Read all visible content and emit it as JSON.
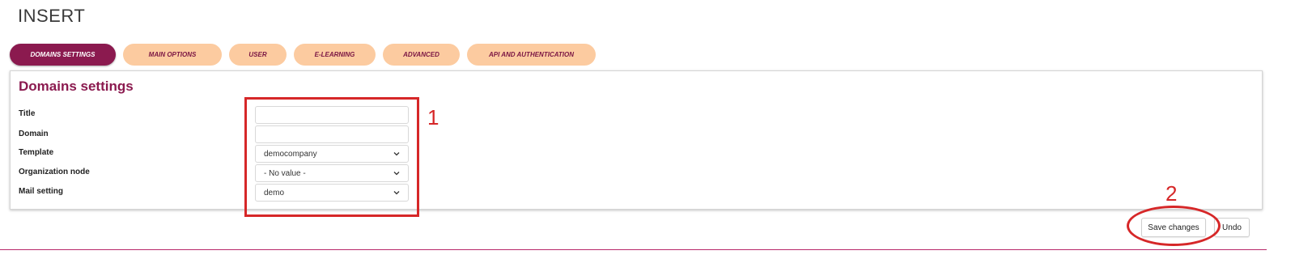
{
  "page": {
    "title": "INSERT"
  },
  "tabs": [
    {
      "label": "DOMAINS SETTINGS",
      "active": true
    },
    {
      "label": "MAIN OPTIONS",
      "active": false
    },
    {
      "label": "USER",
      "active": false
    },
    {
      "label": "E-LEARNING",
      "active": false
    },
    {
      "label": "ADVANCED",
      "active": false
    },
    {
      "label": "API AND AUTHENTICATION",
      "active": false
    }
  ],
  "panel": {
    "title": "Domains settings",
    "fields": [
      {
        "label": "Title",
        "type": "text",
        "value": ""
      },
      {
        "label": "Domain",
        "type": "text",
        "value": ""
      },
      {
        "label": "Template",
        "type": "select",
        "value": "democompany"
      },
      {
        "label": "Organization node",
        "type": "select",
        "value": "- No value -"
      },
      {
        "label": "Mail setting",
        "type": "select",
        "value": "demo"
      }
    ]
  },
  "annotations": {
    "marker_1": "1",
    "marker_2": "2"
  },
  "actions": {
    "save_label": "Save changes",
    "undo_label": "Undo"
  },
  "colors": {
    "brand": "#8b1a4f",
    "tab_inactive": "#fccba0",
    "annotation": "#d62728"
  }
}
